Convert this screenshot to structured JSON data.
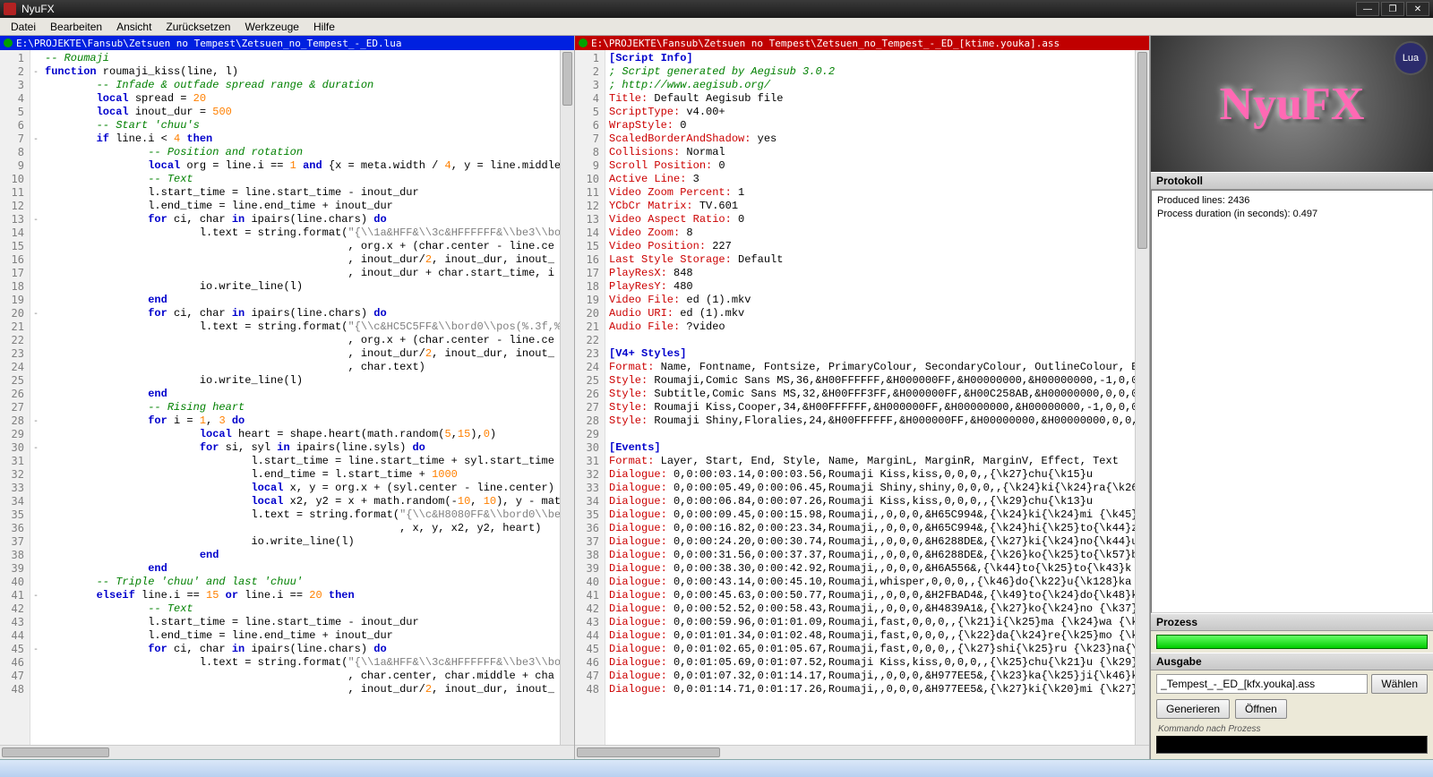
{
  "window": {
    "title": "NyuFX"
  },
  "menu": [
    "Datei",
    "Bearbeiten",
    "Ansicht",
    "Zurücksetzen",
    "Werkzeuge",
    "Hilfe"
  ],
  "leftEditor": {
    "path": "E:\\PROJEKTE\\Fansub\\Zetsuen no Tempest\\Zetsuen_no_Tempest_-_ED.lua",
    "lines": [
      {
        "n": 1,
        "f": "",
        "h": "<span class='c-cmt'>-- Roumaji</span>"
      },
      {
        "n": 2,
        "f": "-",
        "h": "<span class='c-kw'>function</span> roumaji_kiss(line, l)"
      },
      {
        "n": 3,
        "f": "",
        "h": "        <span class='c-cmt'>-- Infade &amp; outfade spread range &amp; duration</span>"
      },
      {
        "n": 4,
        "f": "",
        "h": "        <span class='c-kw'>local</span> spread = <span class='c-num'>20</span>"
      },
      {
        "n": 5,
        "f": "",
        "h": "        <span class='c-kw'>local</span> inout_dur = <span class='c-num'>500</span>"
      },
      {
        "n": 6,
        "f": "",
        "h": "        <span class='c-cmt'>-- Start 'chuu's</span>"
      },
      {
        "n": 7,
        "f": "-",
        "h": "        <span class='c-kw'>if</span> line.i &lt; <span class='c-num'>4</span> <span class='c-kw'>then</span>"
      },
      {
        "n": 8,
        "f": "",
        "h": "                <span class='c-cmt'>-- Position and rotation</span>"
      },
      {
        "n": 9,
        "f": "",
        "h": "                <span class='c-kw'>local</span> org = line.i == <span class='c-num'>1</span> <span class='c-kw'>and</span> {x = meta.width / <span class='c-num'>4</span>, y = line.middle"
      },
      {
        "n": 10,
        "f": "",
        "h": "                <span class='c-cmt'>-- Text</span>"
      },
      {
        "n": 11,
        "f": "",
        "h": "                l.start_time = line.start_time - inout_dur"
      },
      {
        "n": 12,
        "f": "",
        "h": "                l.end_time = line.end_time + inout_dur"
      },
      {
        "n": 13,
        "f": "-",
        "h": "                <span class='c-kw'>for</span> ci, char <span class='c-kw'>in</span> ipairs(line.chars) <span class='c-kw'>do</span>"
      },
      {
        "n": 14,
        "f": "",
        "h": "                        l.text = string.format(<span class='c-str'>\"{\\\\1a&amp;HFF&amp;\\\\3c&amp;HFFFFFF&amp;\\\\be3\\\\bo</span>"
      },
      {
        "n": 15,
        "f": "",
        "h": "                                               , org.x + (char.center - line.ce"
      },
      {
        "n": 16,
        "f": "",
        "h": "                                               , inout_dur/<span class='c-num'>2</span>, inout_dur, inout_"
      },
      {
        "n": 17,
        "f": "",
        "h": "                                               , inout_dur + char.start_time, i"
      },
      {
        "n": 18,
        "f": "",
        "h": "                        io.write_line(l)"
      },
      {
        "n": 19,
        "f": "",
        "h": "                <span class='c-kw'>end</span>"
      },
      {
        "n": 20,
        "f": "-",
        "h": "                <span class='c-kw'>for</span> ci, char <span class='c-kw'>in</span> ipairs(line.chars) <span class='c-kw'>do</span>"
      },
      {
        "n": 21,
        "f": "",
        "h": "                        l.text = string.format(<span class='c-str'>\"{\\\\c&amp;HC5C5FF&amp;\\\\bord0\\\\pos(%.3f,%</span>"
      },
      {
        "n": 22,
        "f": "",
        "h": "                                               , org.x + (char.center - line.ce"
      },
      {
        "n": 23,
        "f": "",
        "h": "                                               , inout_dur/<span class='c-num'>2</span>, inout_dur, inout_"
      },
      {
        "n": 24,
        "f": "",
        "h": "                                               , char.text)"
      },
      {
        "n": 25,
        "f": "",
        "h": "                        io.write_line(l)"
      },
      {
        "n": 26,
        "f": "",
        "h": "                <span class='c-kw'>end</span>"
      },
      {
        "n": 27,
        "f": "",
        "h": "                <span class='c-cmt'>-- Rising heart</span>"
      },
      {
        "n": 28,
        "f": "-",
        "h": "                <span class='c-kw'>for</span> i = <span class='c-num'>1</span>, <span class='c-num'>3</span> <span class='c-kw'>do</span>"
      },
      {
        "n": 29,
        "f": "",
        "h": "                        <span class='c-kw'>local</span> heart = shape.heart(math.random(<span class='c-num'>5</span>,<span class='c-num'>15</span>),<span class='c-num'>0</span>)"
      },
      {
        "n": 30,
        "f": "-",
        "h": "                        <span class='c-kw'>for</span> si, syl <span class='c-kw'>in</span> ipairs(line.syls) <span class='c-kw'>do</span>"
      },
      {
        "n": 31,
        "f": "",
        "h": "                                l.start_time = line.start_time + syl.start_time"
      },
      {
        "n": 32,
        "f": "",
        "h": "                                l.end_time = l.start_time + <span class='c-num'>1000</span>"
      },
      {
        "n": 33,
        "f": "",
        "h": "                                <span class='c-kw'>local</span> x, y = org.x + (syl.center - line.center)"
      },
      {
        "n": 34,
        "f": "",
        "h": "                                <span class='c-kw'>local</span> x2, y2 = x + math.random(-<span class='c-num'>10</span>, <span class='c-num'>10</span>), y - mat"
      },
      {
        "n": 35,
        "f": "",
        "h": "                                l.text = string.format(<span class='c-str'>\"{\\\\c&amp;H8080FF&amp;\\\\bord0\\\\be</span>"
      },
      {
        "n": 36,
        "f": "",
        "h": "                                                       , x, y, x2, y2, heart)"
      },
      {
        "n": 37,
        "f": "",
        "h": "                                io.write_line(l)"
      },
      {
        "n": 38,
        "f": "",
        "h": "                        <span class='c-kw'>end</span>"
      },
      {
        "n": 39,
        "f": "",
        "h": "                <span class='c-kw'>end</span>"
      },
      {
        "n": 40,
        "f": "",
        "h": "        <span class='c-cmt'>-- Triple 'chuu' and last 'chuu'</span>"
      },
      {
        "n": 41,
        "f": "-",
        "h": "        <span class='c-kw'>elseif</span> line.i == <span class='c-num'>15</span> <span class='c-kw'>or</span> line.i == <span class='c-num'>20</span> <span class='c-kw'>then</span>"
      },
      {
        "n": 42,
        "f": "",
        "h": "                <span class='c-cmt'>-- Text</span>"
      },
      {
        "n": 43,
        "f": "",
        "h": "                l.start_time = line.start_time - inout_dur"
      },
      {
        "n": 44,
        "f": "",
        "h": "                l.end_time = line.end_time + inout_dur"
      },
      {
        "n": 45,
        "f": "-",
        "h": "                <span class='c-kw'>for</span> ci, char <span class='c-kw'>in</span> ipairs(line.chars) <span class='c-kw'>do</span>"
      },
      {
        "n": 46,
        "f": "",
        "h": "                        l.text = string.format(<span class='c-str'>\"{\\\\1a&amp;HFF&amp;\\\\3c&amp;HFFFFFF&amp;\\\\be3\\\\bo</span>"
      },
      {
        "n": 47,
        "f": "",
        "h": "                                               , char.center, char.middle + cha"
      },
      {
        "n": 48,
        "f": "",
        "h": "                                               , inout_dur/<span class='c-num'>2</span>, inout_dur, inout_"
      }
    ]
  },
  "rightEditor": {
    "path": "E:\\PROJEKTE\\Fansub\\Zetsuen no Tempest\\Zetsuen_no_Tempest_-_ED_[ktime.youka].ass",
    "lines": [
      {
        "n": 1,
        "h": "<span class='c-sec'>[Script Info]</span>"
      },
      {
        "n": 2,
        "h": "<span class='c-cmt'>; Script generated by Aegisub 3.0.2</span>"
      },
      {
        "n": 3,
        "h": "<span class='c-cmt'>; http://www.aegisub.org/</span>"
      },
      {
        "n": 4,
        "h": "<span class='c-key'>Title:</span> Default Aegisub file"
      },
      {
        "n": 5,
        "h": "<span class='c-key'>ScriptType:</span> v4.00+"
      },
      {
        "n": 6,
        "h": "<span class='c-key'>WrapStyle:</span> 0"
      },
      {
        "n": 7,
        "h": "<span class='c-key'>ScaledBorderAndShadow:</span> yes"
      },
      {
        "n": 8,
        "h": "<span class='c-key'>Collisions:</span> Normal"
      },
      {
        "n": 9,
        "h": "<span class='c-key'>Scroll Position:</span> 0"
      },
      {
        "n": 10,
        "h": "<span class='c-key'>Active Line:</span> 3"
      },
      {
        "n": 11,
        "h": "<span class='c-key'>Video Zoom Percent:</span> 1"
      },
      {
        "n": 12,
        "h": "<span class='c-key'>YCbCr Matrix:</span> TV.601"
      },
      {
        "n": 13,
        "h": "<span class='c-key'>Video Aspect Ratio:</span> 0"
      },
      {
        "n": 14,
        "h": "<span class='c-key'>Video Zoom:</span> 8"
      },
      {
        "n": 15,
        "h": "<span class='c-key'>Video Position:</span> 227"
      },
      {
        "n": 16,
        "h": "<span class='c-key'>Last Style Storage:</span> Default"
      },
      {
        "n": 17,
        "h": "<span class='c-key'>PlayResX:</span> 848"
      },
      {
        "n": 18,
        "h": "<span class='c-key'>PlayResY:</span> 480"
      },
      {
        "n": 19,
        "h": "<span class='c-key'>Video File:</span> ed (1).mkv"
      },
      {
        "n": 20,
        "h": "<span class='c-key'>Audio URI:</span> ed (1).mkv"
      },
      {
        "n": 21,
        "h": "<span class='c-key'>Audio File:</span> ?video"
      },
      {
        "n": 22,
        "h": ""
      },
      {
        "n": 23,
        "h": "<span class='c-sec'>[V4+ Styles]</span>"
      },
      {
        "n": 24,
        "h": "<span class='c-key'>Format:</span> Name, Fontname, Fontsize, PrimaryColour, SecondaryColour, OutlineColour, B"
      },
      {
        "n": 25,
        "h": "<span class='c-key'>Style:</span> Roumaji,Comic Sans MS,36,&amp;H00FFFFFF,&amp;H000000FF,&amp;H00000000,&amp;H00000000,-1,0,0"
      },
      {
        "n": 26,
        "h": "<span class='c-key'>Style:</span> Subtitle,Comic Sans MS,32,&amp;H00FFF3FF,&amp;H000000FF,&amp;H00C258AB,&amp;H00000000,0,0,0"
      },
      {
        "n": 27,
        "h": "<span class='c-key'>Style:</span> Roumaji Kiss,Cooper,34,&amp;H00FFFFFF,&amp;H000000FF,&amp;H00000000,&amp;H00000000,-1,0,0,0"
      },
      {
        "n": 28,
        "h": "<span class='c-key'>Style:</span> Roumaji Shiny,Floralies,24,&amp;H00FFFFFF,&amp;H000000FF,&amp;H00000000,&amp;H00000000,0,0,"
      },
      {
        "n": 29,
        "h": ""
      },
      {
        "n": 30,
        "h": "<span class='c-sec'>[Events]</span>"
      },
      {
        "n": 31,
        "h": "<span class='c-key'>Format:</span> Layer, Start, End, Style, Name, MarginL, MarginR, MarginV, Effect, Text"
      },
      {
        "n": 32,
        "h": "<span class='c-key'>Dialogue:</span> 0,0:00:03.14,0:00:03.56,Roumaji Kiss,kiss,0,0,0,,{\\k27}chu{\\k15}u"
      },
      {
        "n": 33,
        "h": "<span class='c-key'>Dialogue:</span> 0,0:00:05.49,0:00:06.45,Roumaji Shiny,shiny,0,0,0,,{\\k24}ki{\\k24}ra{\\k26"
      },
      {
        "n": 34,
        "h": "<span class='c-key'>Dialogue:</span> 0,0:00:06.84,0:00:07.26,Roumaji Kiss,kiss,0,0,0,,{\\k29}chu{\\k13}u"
      },
      {
        "n": 35,
        "h": "<span class='c-key'>Dialogue:</span> 0,0:00:09.45,0:00:15.98,Roumaji,,0,0,0,&amp;H65C994&amp;,{\\k24}ki{\\k24}mi {\\k45}"
      },
      {
        "n": 36,
        "h": "<span class='c-key'>Dialogue:</span> 0,0:00:16.82,0:00:23.34,Roumaji,,0,0,0,&amp;H65C994&amp;,{\\k24}hi{\\k25}to{\\k44}z"
      },
      {
        "n": 37,
        "h": "<span class='c-key'>Dialogue:</span> 0,0:00:24.20,0:00:30.74,Roumaji,,0,0,0,&amp;H6288DE&amp;,{\\k27}ki{\\k24}no{\\k44}u"
      },
      {
        "n": 38,
        "h": "<span class='c-key'>Dialogue:</span> 0,0:00:31.56,0:00:37.37,Roumaji,,0,0,0,&amp;H6288DE&amp;,{\\k26}ko{\\k25}to{\\k57}b"
      },
      {
        "n": 39,
        "h": "<span class='c-key'>Dialogue:</span> 0,0:00:38.30,0:00:42.92,Roumaji,,0,0,0,&amp;H6A556&amp;,{\\k44}to{\\k25}to{\\k43}k"
      },
      {
        "n": 40,
        "h": "<span class='c-key'>Dialogue:</span> 0,0:00:43.14,0:00:45.10,Roumaji,whisper,0,0,0,,{\\k46}do{\\k22}u{\\k128}ka"
      },
      {
        "n": 41,
        "h": "<span class='c-key'>Dialogue:</span> 0,0:00:45.63,0:00:50.77,Roumaji,,0,0,0,&amp;H2FBAD4&amp;,{\\k49}to{\\k24}do{\\k48}k"
      },
      {
        "n": 42,
        "h": "<span class='c-key'>Dialogue:</span> 0,0:00:52.52,0:00:58.43,Roumaji,,0,0,0,&amp;H4839A1&amp;,{\\k27}ko{\\k24}no {\\k37}"
      },
      {
        "n": 43,
        "h": "<span class='c-key'>Dialogue:</span> 0,0:00:59.96,0:01:01.09,Roumaji,fast,0,0,0,,{\\k21}i{\\k25}ma {\\k24}wa {\\k"
      },
      {
        "n": 44,
        "h": "<span class='c-key'>Dialogue:</span> 0,0:01:01.34,0:01:02.48,Roumaji,fast,0,0,0,,{\\k22}da{\\k24}re{\\k25}mo {\\k"
      },
      {
        "n": 45,
        "h": "<span class='c-key'>Dialogue:</span> 0,0:01:02.65,0:01:05.67,Roumaji,fast,0,0,0,,{\\k27}shi{\\k25}ru {\\k23}na{\\"
      },
      {
        "n": 46,
        "h": "<span class='c-key'>Dialogue:</span> 0,0:01:05.69,0:01:07.52,Roumaji Kiss,kiss,0,0,0,,{\\k25}chu{\\k21}u {\\k29}"
      },
      {
        "n": 47,
        "h": "<span class='c-key'>Dialogue:</span> 0,0:01:07.32,0:01:14.17,Roumaji,,0,0,0,&amp;H977EE5&amp;,{\\k23}ka{\\k25}ji{\\k46}k"
      },
      {
        "n": 48,
        "h": "<span class='c-key'>Dialogue:</span> 0,0:01:14.71,0:01:17.26,Roumaji,,0,0,0,&amp;H977EE5&amp;,{\\k27}ki{\\k20}mi {\\k27}"
      }
    ]
  },
  "sidebar": {
    "logo": "NyuFX",
    "luaBadge": "Lua",
    "protokollTitle": "Protokoll",
    "protokollLines": [
      "Produced lines: 2436",
      "Process duration (in seconds): 0.497"
    ],
    "prozessTitle": "Prozess",
    "ausgabeTitle": "Ausgabe",
    "outputFile": "_Tempest_-_ED_[kfx.youka].ass",
    "waehlen": "Wählen",
    "generieren": "Generieren",
    "oeffnen": "Öffnen",
    "cmdLabel": "Kommando nach Prozess"
  }
}
